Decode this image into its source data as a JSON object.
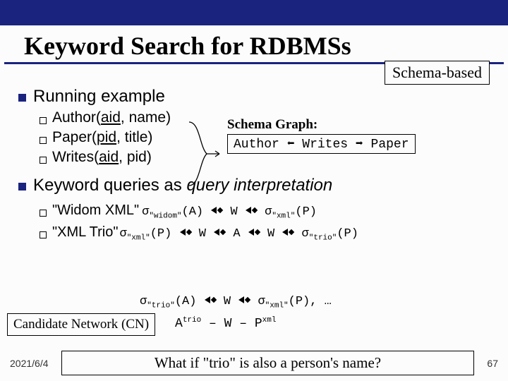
{
  "title": "Keyword Search for RDBMSs",
  "badge_schema": "Schema-based",
  "sec1": {
    "heading": "Running example",
    "items": [
      {
        "rel": "Author",
        "key": "aid",
        "rest": ", name)"
      },
      {
        "rel": "Paper",
        "key": "pid",
        "rest": ", title)"
      },
      {
        "rel": "Writes",
        "key": "aid",
        "rest": ", pid)"
      }
    ]
  },
  "schema_graph": {
    "title": "Schema Graph:",
    "a": "Author",
    "b": "Writes",
    "c": "Paper"
  },
  "sec2": {
    "heading_a": "Keyword queries as ",
    "heading_b": "query interpretation"
  },
  "q1": {
    "label": "\"Widom XML\"",
    "sigma": "σ",
    "sub1": "\"widom\"",
    "ap": "(A)",
    "W": "W",
    "sub2": "\"xml\"",
    "pp": "(P)"
  },
  "q2": {
    "label": "\"XML Trio\"",
    "sub1": "\"xml\"",
    "pp": "(P)",
    "W": "W",
    "A": "A",
    "sub2": "\"trio\"",
    "pp2": "(P)"
  },
  "q3": {
    "sub1": "\"trio\"",
    "ap": "(A)",
    "W": "W",
    "sub2": "\"xml\"",
    "pp": "(P)",
    "tail": ", …"
  },
  "cn": {
    "label": "Candidate Network (CN)",
    "expr_a": "A",
    "expr_a_sup": "trio",
    "dash": " – ",
    "expr_w": "W",
    "expr_p": "P",
    "expr_p_sup": "xml"
  },
  "footer": {
    "date": "2021/6/4",
    "note": "What if \"trio\" is also a person's name?",
    "page": "67"
  }
}
